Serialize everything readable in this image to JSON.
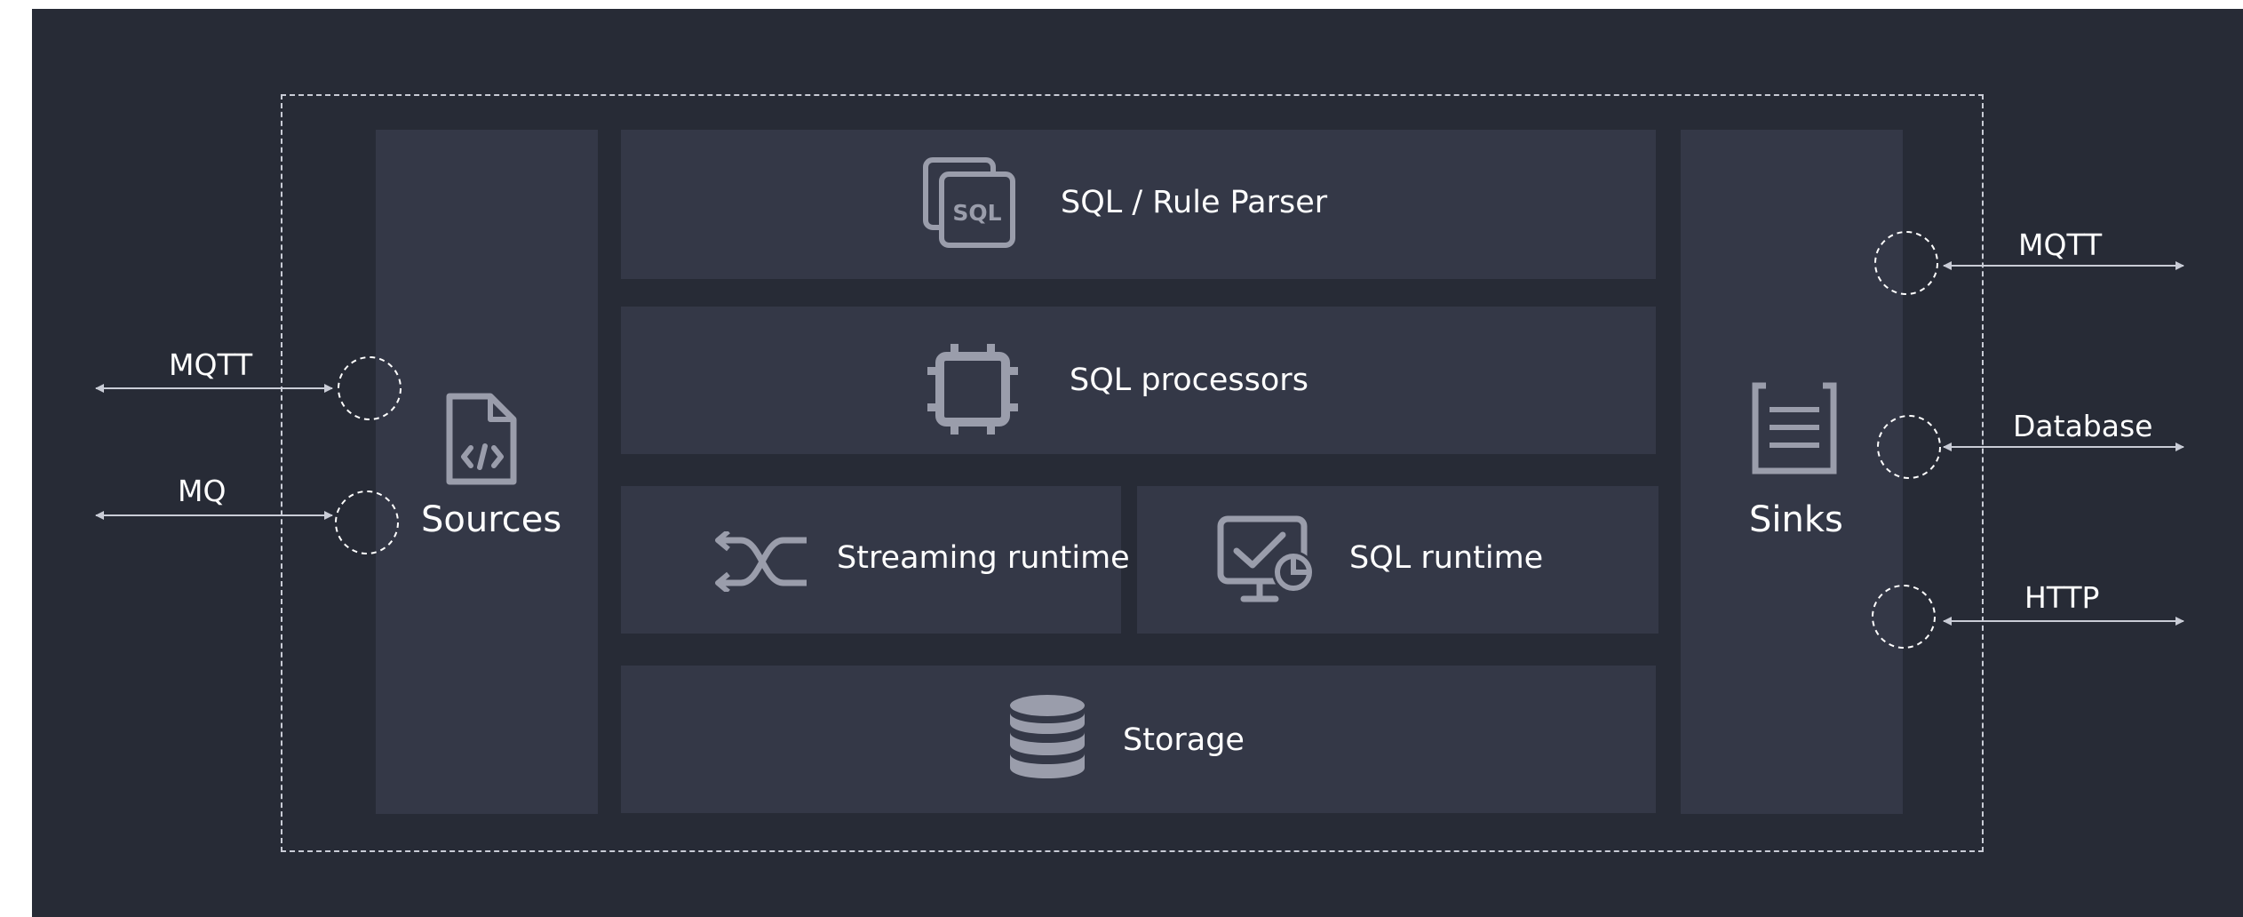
{
  "diagram": {
    "sources": {
      "label": "Sources",
      "icon": "code-file-icon"
    },
    "sinks": {
      "label": "Sinks",
      "icon": "list-document-icon"
    },
    "modules": {
      "parser": {
        "label": "SQL / Rule Parser",
        "icon": "sql-icon",
        "icon_text": "SQL"
      },
      "processors": {
        "label": "SQL processors",
        "icon": "chip-icon"
      },
      "streaming": {
        "label": "Streaming runtime",
        "icon": "shuffle-icon"
      },
      "sql_runtime": {
        "label": "SQL runtime",
        "icon": "monitor-check-icon"
      },
      "storage": {
        "label": "Storage",
        "icon": "database-icon"
      }
    },
    "inputs": [
      {
        "label": "MQTT"
      },
      {
        "label": "MQ"
      }
    ],
    "outputs": [
      {
        "label": "MQTT"
      },
      {
        "label": "Database"
      },
      {
        "label": "HTTP"
      }
    ],
    "colors": {
      "background": "#272b36",
      "panel": "#343847",
      "icon": "#9a9dab",
      "text": "#ffffff",
      "dashed": "#c9ccd6"
    }
  }
}
